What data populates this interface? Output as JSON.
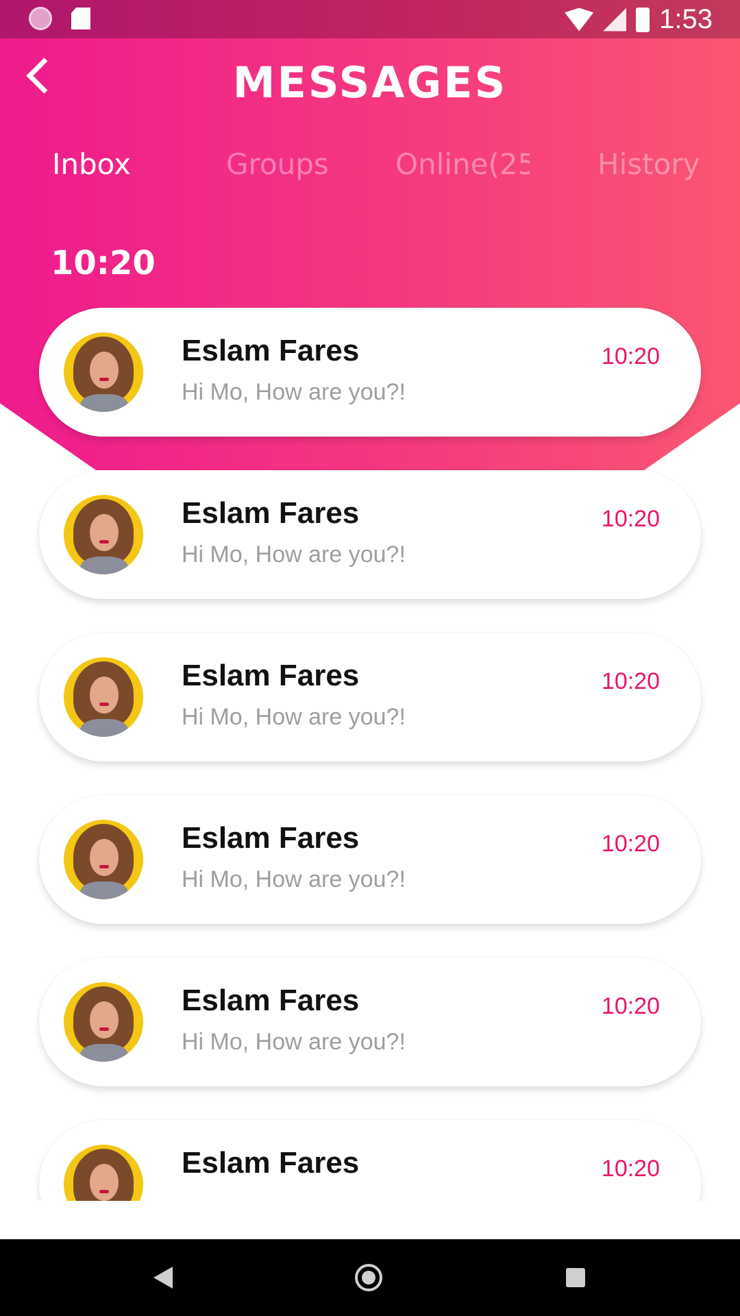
{
  "status_bar": {
    "time": "1:53"
  },
  "header": {
    "title": "MESSAGES"
  },
  "tabs": [
    {
      "label": "Inbox",
      "active": true
    },
    {
      "label": "Groups",
      "active": false
    },
    {
      "label": "Online(25",
      "active": false
    },
    {
      "label": "History",
      "active": false
    }
  ],
  "section": {
    "time_label": "10:20"
  },
  "messages": [
    {
      "name": "Eslam Fares",
      "preview": "Hi Mo, How are you?!",
      "time": "10:20"
    },
    {
      "name": "Eslam Fares",
      "preview": "Hi Mo, How are you?!",
      "time": "10:20"
    },
    {
      "name": "Eslam Fares",
      "preview": "Hi Mo, How are you?!",
      "time": "10:20"
    },
    {
      "name": "Eslam Fares",
      "preview": "Hi Mo, How are you?!",
      "time": "10:20"
    },
    {
      "name": "Eslam Fares",
      "preview": "Hi Mo, How are you?!",
      "time": "10:20"
    },
    {
      "name": "Eslam Fares",
      "preview": "",
      "time": "10:20"
    }
  ],
  "colors": {
    "accent": "#e8146b",
    "gradient_start": "#ee1b8d",
    "gradient_end": "#fa5672"
  }
}
